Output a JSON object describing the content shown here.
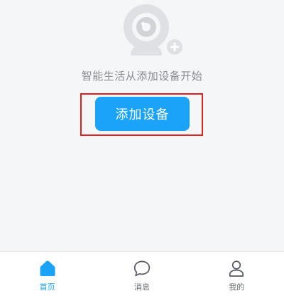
{
  "empty_state": {
    "message": "智能生活从添加设备开始",
    "illustration_icon": "camera-plus-icon",
    "add_button_label": "添加设备"
  },
  "colors": {
    "accent": "#1aa3f8",
    "highlight": "#e0201e"
  },
  "tabbar": {
    "items": [
      {
        "label": "首页",
        "icon": "home-icon",
        "active": true
      },
      {
        "label": "消息",
        "icon": "chat-bubble-icon",
        "active": false
      },
      {
        "label": "我的",
        "icon": "person-icon",
        "active": false
      }
    ]
  }
}
